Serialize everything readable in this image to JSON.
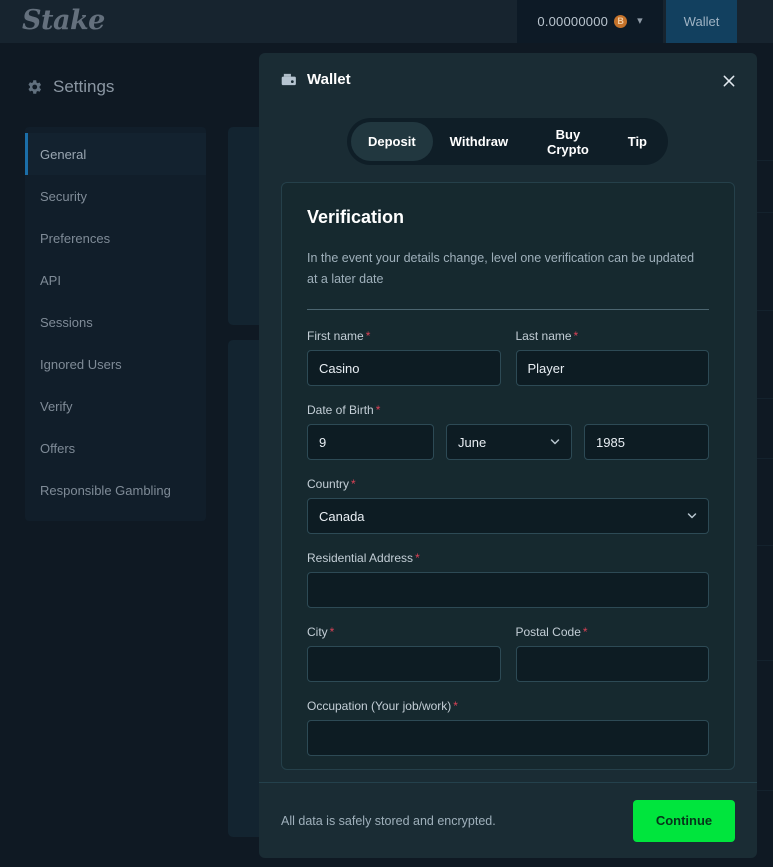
{
  "topbar": {
    "logo_text": "Stake",
    "balance": "0.00000000",
    "coin_symbol": "₿",
    "wallet_button": "Wallet"
  },
  "sidebar": {
    "heading": "Settings",
    "items": [
      {
        "label": "General"
      },
      {
        "label": "Security"
      },
      {
        "label": "Preferences"
      },
      {
        "label": "API"
      },
      {
        "label": "Sessions"
      },
      {
        "label": "Ignored Users"
      },
      {
        "label": "Verify"
      },
      {
        "label": "Offers"
      },
      {
        "label": "Responsible Gambling"
      }
    ],
    "active_index": 0
  },
  "modal": {
    "title": "Wallet",
    "tabs": [
      {
        "label": "Deposit",
        "active": true
      },
      {
        "label": "Withdraw",
        "active": false
      },
      {
        "label": "Buy Crypto",
        "active": false
      },
      {
        "label": "Tip",
        "active": false
      }
    ],
    "verification": {
      "title": "Verification",
      "description": "In the event your details change, level one verification can be updated at a later date",
      "first_name": {
        "label": "First name",
        "required": "*",
        "value": "Casino"
      },
      "last_name": {
        "label": "Last name",
        "required": "*",
        "value": "Player"
      },
      "dob": {
        "label": "Date of Birth",
        "required": "*",
        "day": "9",
        "month": "June",
        "year": "1985"
      },
      "country": {
        "label": "Country",
        "required": "*",
        "value": "Canada"
      },
      "address": {
        "label": "Residential Address",
        "required": "*",
        "value": ""
      },
      "city": {
        "label": "City",
        "required": "*",
        "value": ""
      },
      "postal_code": {
        "label": "Postal Code",
        "required": "*",
        "value": ""
      },
      "occupation": {
        "label": "Occupation (Your job/work)",
        "required": "*",
        "value": ""
      }
    },
    "footer": {
      "note": "All data is safely stored and encrypted.",
      "continue_label": "Continue"
    }
  },
  "colors": {
    "page_bg": "#0f1923",
    "modal_bg": "#1a2c34",
    "accent_green": "#00e53d",
    "accent_blue": "#12405f",
    "required_red": "#d94256",
    "coin_orange": "#c4722a"
  }
}
